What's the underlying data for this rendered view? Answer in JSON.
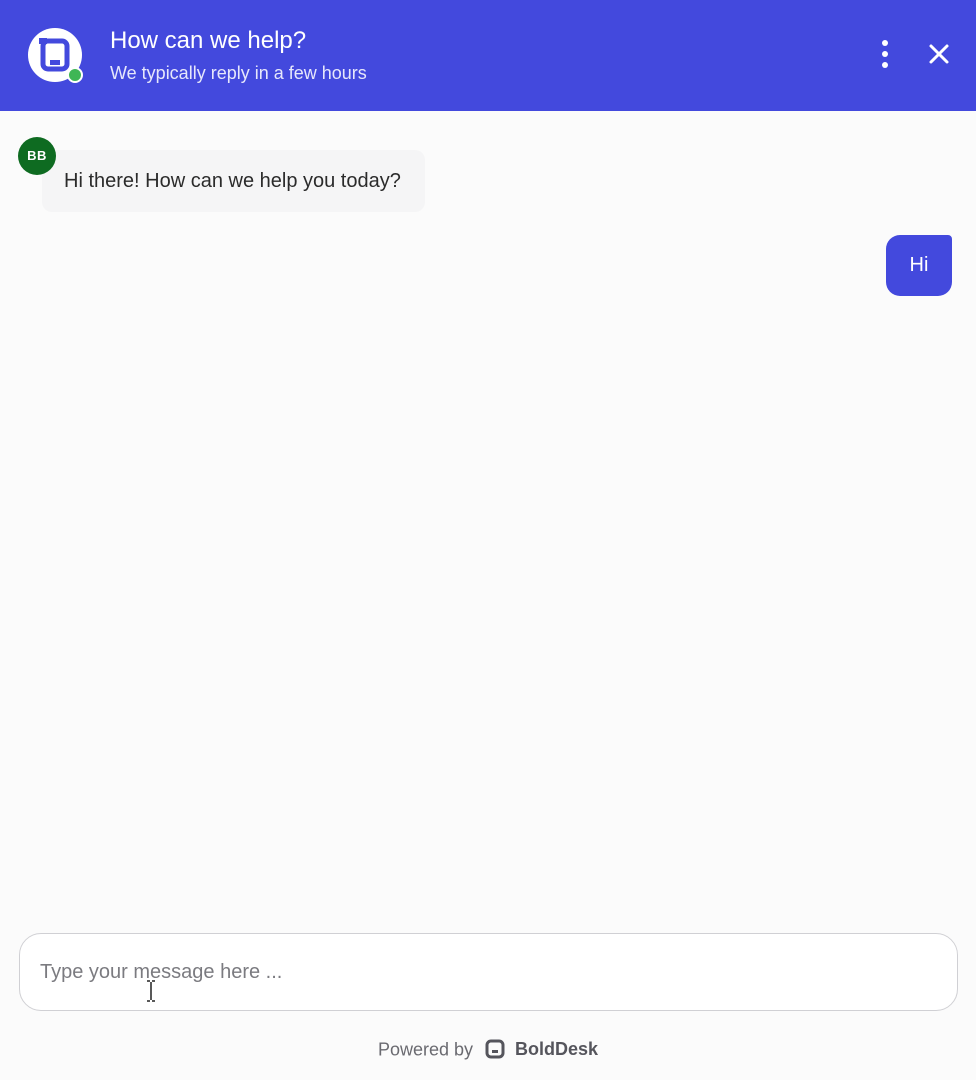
{
  "header": {
    "title": "How can we help?",
    "subtitle": "We typically reply in a few hours",
    "logo_icon": "bolddesk-logo-icon",
    "status": "online",
    "menu_icon": "more-vertical-icon",
    "close_icon": "close-icon",
    "colors": {
      "background": "#4349dd",
      "status_online": "#3fb655"
    }
  },
  "conversation": {
    "messages": [
      {
        "sender": "agent",
        "avatar_initials": "BB",
        "avatar_color": "#0e6b21",
        "text": "Hi there! How can we help you today?"
      },
      {
        "sender": "user",
        "text": "Hi",
        "bubble_color": "#4349dd"
      }
    ]
  },
  "composer": {
    "placeholder": "Type your message here ...",
    "value": ""
  },
  "footer": {
    "powered_by": "Powered by",
    "brand": "BoldDesk"
  }
}
